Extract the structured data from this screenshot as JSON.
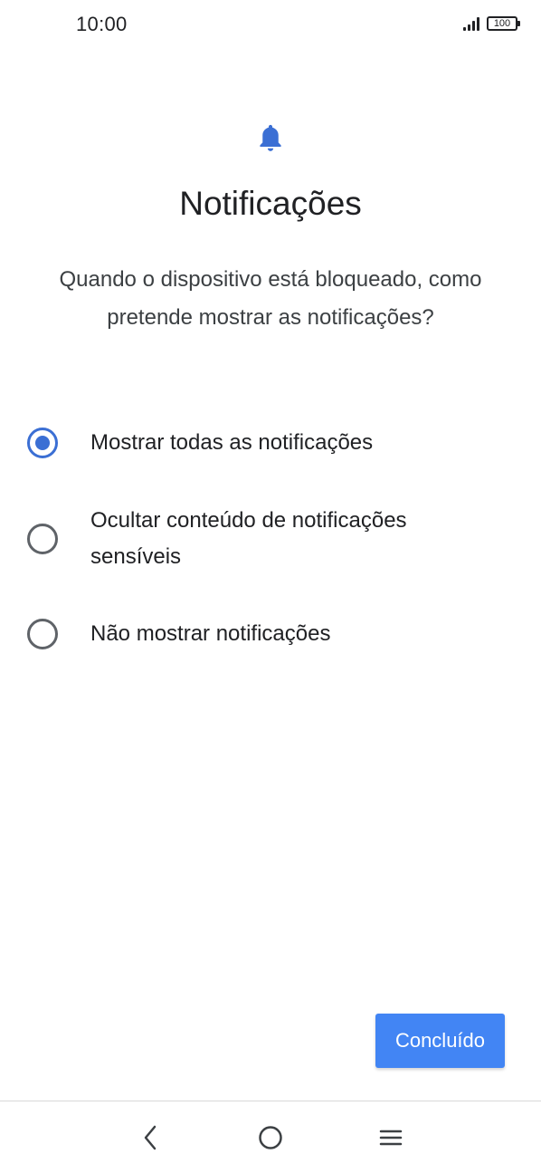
{
  "status_bar": {
    "time": "10:00",
    "battery_level": "100",
    "signal_icon": "signal-bars-icon"
  },
  "header": {
    "icon": "bell-icon",
    "accent_color": "#3b6fd4",
    "title": "Notificações",
    "subtitle": "Quando o dispositivo está bloqueado, como pretende mostrar as notificações?"
  },
  "options": [
    {
      "label": "Mostrar todas as notificações",
      "selected": true
    },
    {
      "label": "Ocultar conteúdo de notificações sensíveis",
      "selected": false
    },
    {
      "label": "Não mostrar notificações",
      "selected": false
    }
  ],
  "footer": {
    "done_label": "Concluído",
    "button_color": "#4285f4"
  },
  "nav_bar": {
    "back_icon": "back-chevron-icon",
    "home_icon": "home-circle-icon",
    "menu_icon": "menu-lines-icon"
  }
}
